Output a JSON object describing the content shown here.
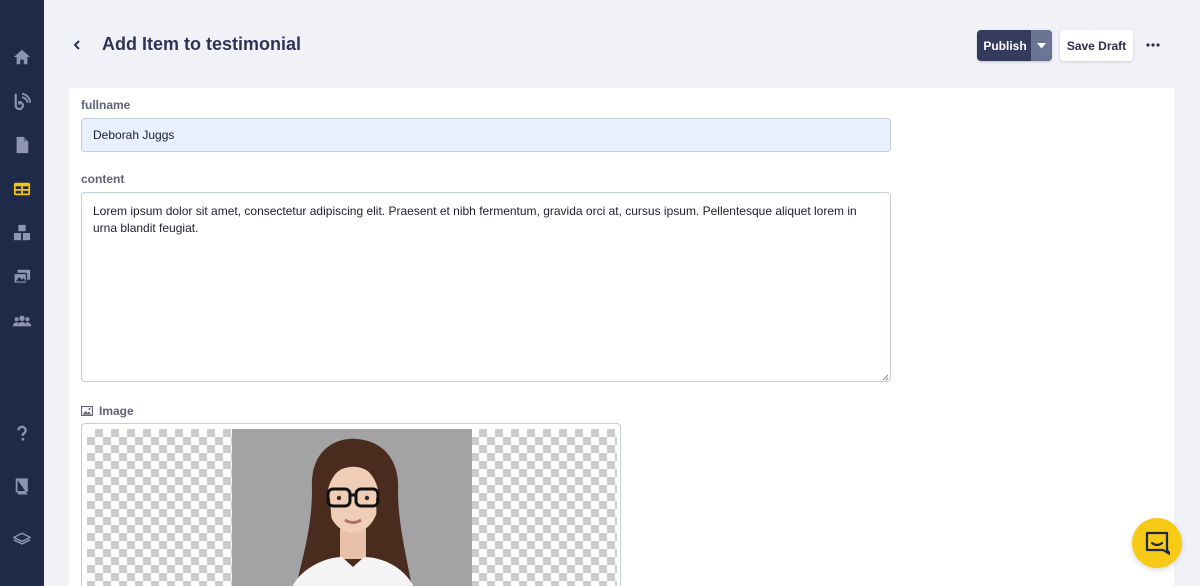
{
  "header": {
    "title": "Add Item to testimonial",
    "publish_label": "Publish",
    "save_draft_label": "Save Draft"
  },
  "sidebar": {
    "items": [
      {
        "icon": "home-icon"
      },
      {
        "icon": "blog-icon"
      },
      {
        "icon": "page-icon"
      },
      {
        "icon": "collection-icon",
        "active": true
      },
      {
        "icon": "components-icon"
      },
      {
        "icon": "media-icon"
      },
      {
        "icon": "users-icon"
      },
      {
        "icon": "help-icon"
      },
      {
        "icon": "docs-icon"
      },
      {
        "icon": "layers-icon"
      }
    ]
  },
  "form": {
    "fullname_label": "fullname",
    "fullname_value": "Deborah Juggs",
    "content_label": "content",
    "content_value": "Lorem ipsum dolor sit amet, consectetur adipiscing elit. Praesent et nibh fermentum, gravida orci at, cursus ipsum. Pellentesque aliquet lorem in urna blandit feugiat.",
    "image_label": "Image"
  },
  "colors": {
    "sidebar_bg": "#1f2a48",
    "active_icon": "#f2c511",
    "publish_bg": "#343b5c",
    "chat_button": "#f7cb15"
  }
}
